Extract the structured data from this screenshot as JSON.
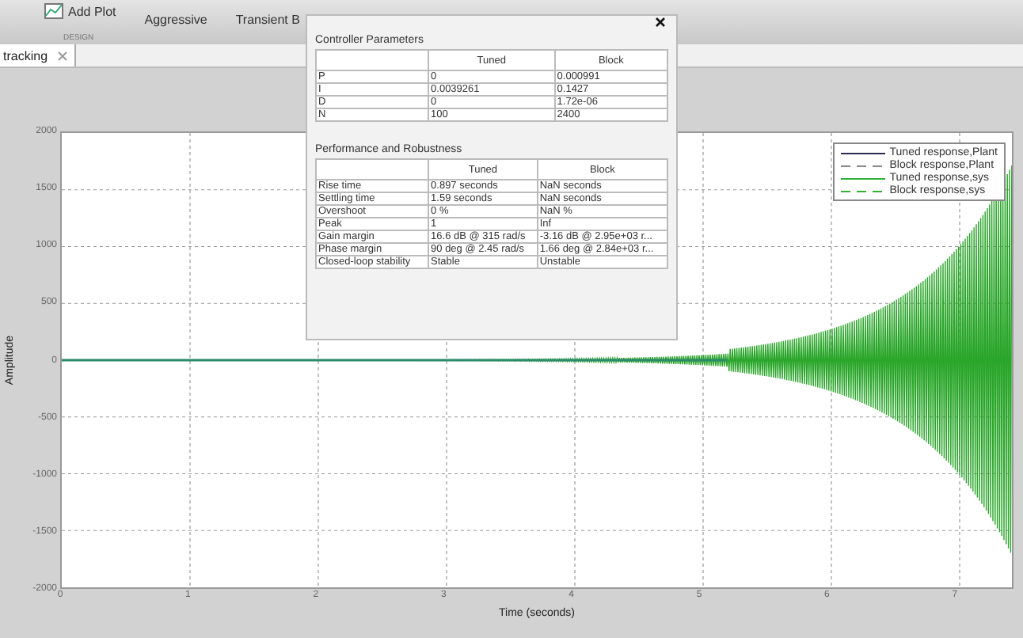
{
  "toolbar": {
    "items": [
      {
        "label": "Add Plot",
        "kind": "icon-button"
      },
      {
        "label": "Aggressive",
        "kind": "label"
      },
      {
        "label": "Transient B",
        "kind": "label"
      }
    ],
    "sections": [
      "DESIGN"
    ]
  },
  "tabs": [
    {
      "label": "tracking",
      "selected": true
    }
  ],
  "plot": {
    "ylabel": "Amplitude",
    "xlabel": "Time (seconds)",
    "yticks": [
      "2000",
      "1500",
      "1000",
      "500",
      "0",
      "-500",
      "-1000",
      "-1500",
      "-2000"
    ],
    "xticks": [
      "0",
      "1",
      "2",
      "3",
      "4",
      "5",
      "6",
      "7"
    ],
    "legend": [
      {
        "label": "Tuned response,Plant",
        "color": "#2b2b50",
        "dashed": false
      },
      {
        "label": "Block response,Plant",
        "color": "#8a8a8a",
        "dashed": true
      },
      {
        "label": "Tuned response,sys",
        "color": "#33b033",
        "dashed": false
      },
      {
        "label": "Block response,sys",
        "color": "#33b033",
        "dashed": true
      }
    ]
  },
  "dialog": {
    "sections": [
      {
        "title": "Controller Parameters",
        "columns": [
          "",
          "Tuned",
          "Block"
        ],
        "rows": [
          [
            "P",
            "0",
            "0.000991"
          ],
          [
            "I",
            "0.0039261",
            "0.1427"
          ],
          [
            "D",
            "0",
            "1.72e-06"
          ],
          [
            "N",
            "100",
            "2400"
          ]
        ]
      },
      {
        "title": "Performance and Robustness",
        "columns": [
          "",
          "Tuned",
          "Block"
        ],
        "rows": [
          [
            "Rise time",
            "0.897 seconds",
            "NaN seconds"
          ],
          [
            "Settling time",
            "1.59 seconds",
            "NaN seconds"
          ],
          [
            "Overshoot",
            "0 %",
            "NaN %"
          ],
          [
            "Peak",
            "1",
            "Inf"
          ],
          [
            "Gain margin",
            "16.6 dB @ 315 rad/s",
            "-3.16 dB @ 2.95e+03 r..."
          ],
          [
            "Phase margin",
            "90 deg @ 2.45 rad/s",
            "1.66 deg @ 2.84e+03 r..."
          ],
          [
            "Closed-loop stability",
            "Stable",
            "Unstable"
          ]
        ]
      }
    ]
  }
}
